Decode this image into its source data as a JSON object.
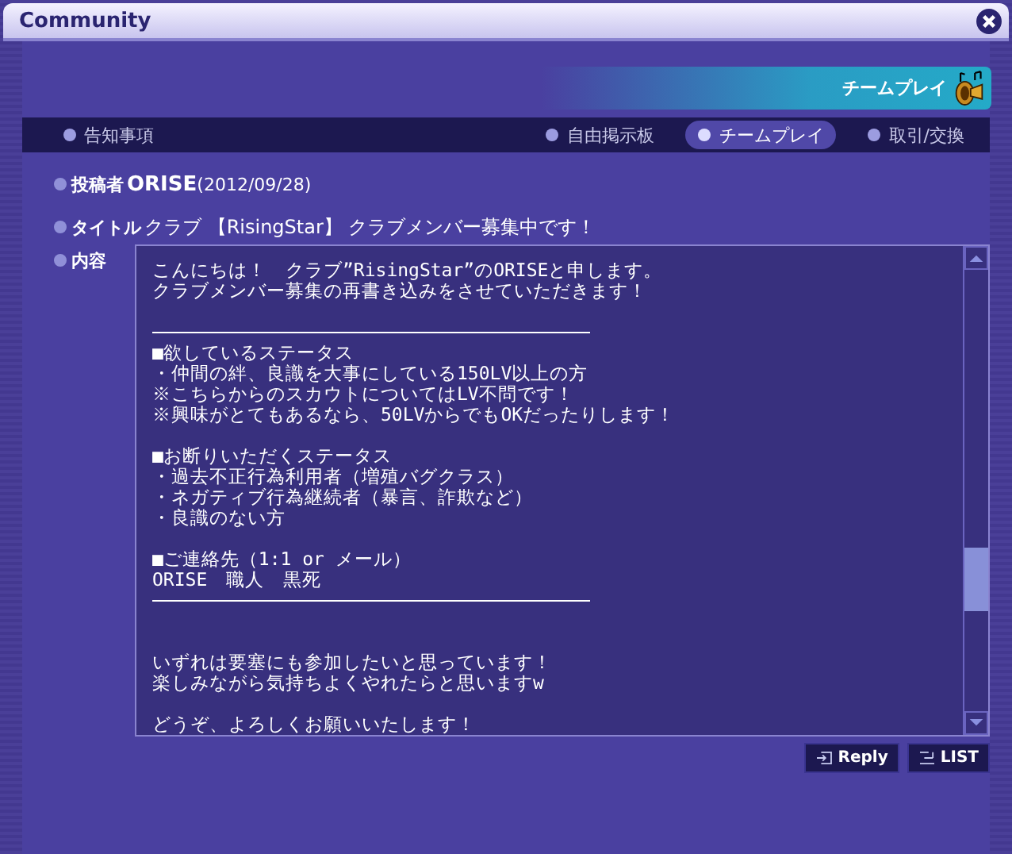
{
  "window": {
    "title": "Community"
  },
  "banner": {
    "label": "チームプレイ"
  },
  "tabs": [
    {
      "label": "告知事項",
      "selected": false
    },
    {
      "label": "自由掲示板",
      "selected": false
    },
    {
      "label": "チームプレイ",
      "selected": true
    },
    {
      "label": "取引/交換",
      "selected": false
    }
  ],
  "post": {
    "author_label": "投稿者",
    "author": "ORISE",
    "date": "(2012/09/28)",
    "title_label": "タイトル",
    "title": "クラブ 【RisingStar】 クラブメンバー募集中です！",
    "content_label": "内容",
    "body": [
      {
        "kind": "text",
        "lines": [
          "こんにちは！　クラブ”RisingStar”のORISEと申します。",
          "クラブメンバー募集の再書き込みをさせていただきます！"
        ]
      },
      {
        "kind": "gap"
      },
      {
        "kind": "rule"
      },
      {
        "kind": "text",
        "lines": [
          "■欲しているステータス",
          "・仲間の絆、良識を大事にしている150LV以上の方",
          "※こちらからのスカウトについてはLV不問です！",
          "※興味がとてもあるなら、50LVからでもOKだったりします！"
        ]
      },
      {
        "kind": "gap"
      },
      {
        "kind": "text",
        "lines": [
          "■お断りいただくステータス",
          "・過去不正行為利用者（増殖バグクラス）",
          "・ネガティブ行為継続者（暴言、詐欺など）",
          "・良識のない方"
        ]
      },
      {
        "kind": "gap"
      },
      {
        "kind": "text",
        "lines": [
          "■ご連絡先（1:1 or メール）",
          "ORISE　職人　黒死"
        ]
      },
      {
        "kind": "rule"
      },
      {
        "kind": "gap"
      },
      {
        "kind": "gap"
      },
      {
        "kind": "text",
        "lines": [
          "いずれは要塞にも参加したいと思っています！",
          "楽しみながら気持ちよくやれたらと思いますw"
        ]
      },
      {
        "kind": "gap"
      },
      {
        "kind": "text",
        "lines": [
          "どうぞ、よろしくお願いいたします！"
        ]
      }
    ]
  },
  "buttons": [
    {
      "kind": "reply",
      "label": "Reply"
    },
    {
      "kind": "list",
      "label": "LIST"
    }
  ]
}
